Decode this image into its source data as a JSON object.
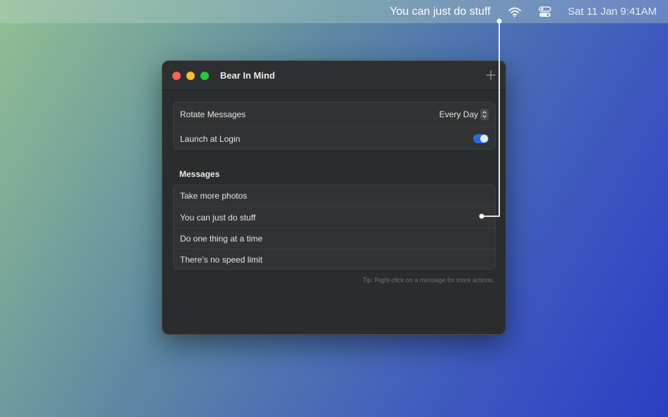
{
  "menubar": {
    "message": "You can just do stuff",
    "wifi_icon": "wifi-icon",
    "control_center_icon": "control-center-icon",
    "clock": "Sat 11 Jan 9:41AM"
  },
  "window": {
    "title": "Bear In Mind",
    "add_icon": "plus-icon",
    "settings": {
      "rotate_label": "Rotate Messages",
      "rotate_value": "Every Day",
      "launch_label": "Launch at Login",
      "launch_enabled": true
    },
    "messages_title": "Messages",
    "messages": [
      "Take more photos",
      "You can just do stuff",
      "Do one thing at a time",
      "There’s no speed limit"
    ],
    "tip": "Tip: Right-click on a message for more actions."
  },
  "colors": {
    "toggle_on": "#2f6ad8",
    "window_bg": "#2a2c2e",
    "close": "#fe5f57",
    "minimize": "#febc2e",
    "maximize": "#28c840"
  }
}
